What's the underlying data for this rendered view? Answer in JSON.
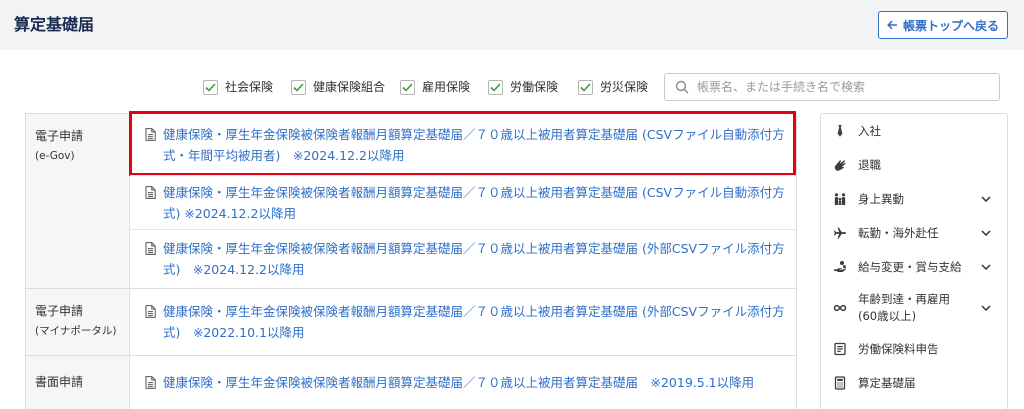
{
  "colors": {
    "accent": "#2f6fc8",
    "title": "#1b2a50",
    "highlight": "#e50012",
    "check": "#3d9b3d",
    "header_bg": "#f2f3f5"
  },
  "header": {
    "title": "算定基礎届",
    "back_button": {
      "label": "帳票トップへ戻る",
      "icon": "arrow-left-icon"
    }
  },
  "filters": [
    {
      "label": "社会保険",
      "checked": true
    },
    {
      "label": "健康保険組合",
      "checked": true
    },
    {
      "label": "雇用保険",
      "checked": true
    },
    {
      "label": "労働保険",
      "checked": true
    },
    {
      "label": "労災保険",
      "checked": true
    }
  ],
  "search": {
    "placeholder": "帳票名、または手続き名で検索",
    "icon": "search-icon"
  },
  "groups": [
    {
      "category": "電子申請",
      "sub": "(e-Gov)",
      "items": [
        {
          "title": "健康保険・厚生年金保険被保険者報酬月額算定基礎届／７０歳以上被用者算定基礎届 (CSVファイル自動添付方式・年間平均被用者)　※2024.12.2以降用",
          "highlighted": true
        },
        {
          "title": "健康保険・厚生年金保険被保険者報酬月額算定基礎届／７０歳以上被用者算定基礎届 (CSVファイル自動添付方式) ※2024.12.2以降用",
          "highlighted": false
        },
        {
          "title": "健康保険・厚生年金保険被保険者報酬月額算定基礎届／７０歳以上被用者算定基礎届 (外部CSVファイル添付方式)　※2024.12.2以降用",
          "highlighted": false
        }
      ]
    },
    {
      "category": "電子申請",
      "sub": "(マイナポータル)",
      "items": [
        {
          "title": "健康保険・厚生年金保険被保険者報酬月額算定基礎届／７０歳以上被用者算定基礎届 (外部CSVファイル添付方式)　※2022.10.1以降用",
          "highlighted": false
        }
      ]
    },
    {
      "category": "書面申請",
      "items": [
        {
          "title": "健康保険・厚生年金保険被保険者報酬月額算定基礎届／７０歳以上被用者算定基礎届　※2019.5.1以降用",
          "highlighted": false
        }
      ]
    }
  ],
  "sidebar": {
    "items": [
      {
        "label": "入社",
        "icon": "necktie-icon",
        "has_submenu": false
      },
      {
        "label": "退職",
        "icon": "waving-hand-icon",
        "has_submenu": false
      },
      {
        "label": "身上異動",
        "icon": "family-icon",
        "has_submenu": true
      },
      {
        "label": "転勤・海外赴任",
        "icon": "airplane-icon",
        "has_submenu": true
      },
      {
        "label": "給与変更・賞与支給",
        "icon": "coin-hand-icon",
        "has_submenu": true
      },
      {
        "label": "年齢到達・再雇用",
        "label_line2": "(60歳以上)",
        "icon": "infinity-icon",
        "has_submenu": true
      },
      {
        "label": "労働保険料申告",
        "icon": "document-list-icon",
        "has_submenu": false
      },
      {
        "label": "算定基礎届",
        "icon": "calculator-icon",
        "has_submenu": false
      }
    ]
  }
}
